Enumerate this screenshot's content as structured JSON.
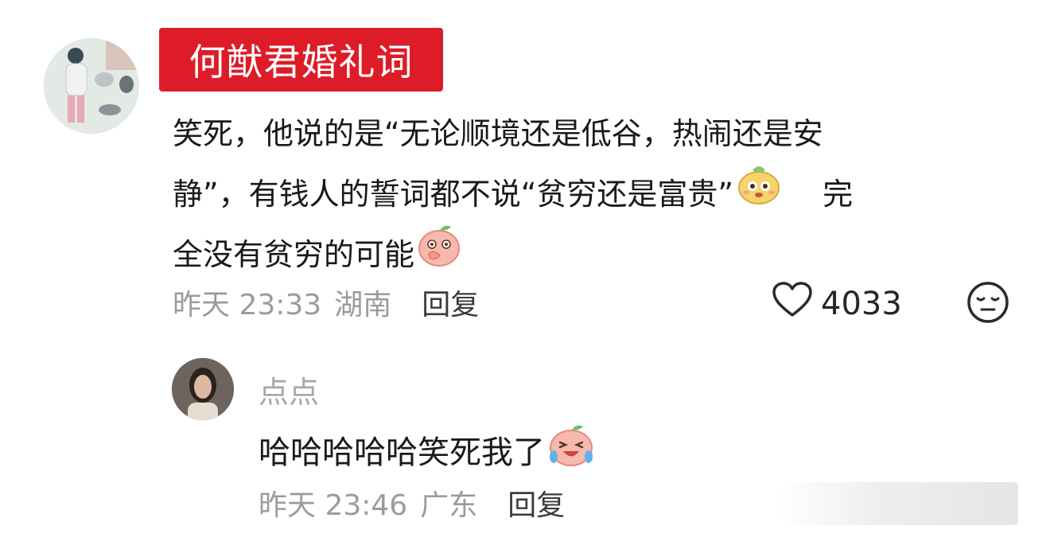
{
  "comment": {
    "title": "何猷君婚礼词",
    "text_lines": [
      "笑死，他说的是“无论顺境还是低谷，热闹还是安",
      "静”，有钱人的誓词都不说“贫穷还是富贵”",
      "完",
      "全没有贫穷的可能"
    ],
    "emojis": [
      "smug-emoji-icon",
      "covering-mouth-emoji-icon"
    ],
    "time": "昨天 23:33",
    "location": "湖南",
    "reply_label": "回复",
    "like_count": "4033"
  },
  "reply": {
    "username": "点点",
    "text": "哈哈哈哈哈笑死我了",
    "emoji": "laughing-crying-emoji-icon",
    "time": "昨天 23:46",
    "location": "广东",
    "reply_label": "回复"
  },
  "colors": {
    "title_badge": "#dd1c28",
    "meta_gray": "#9b9b9b",
    "text": "#1a1a1a"
  }
}
